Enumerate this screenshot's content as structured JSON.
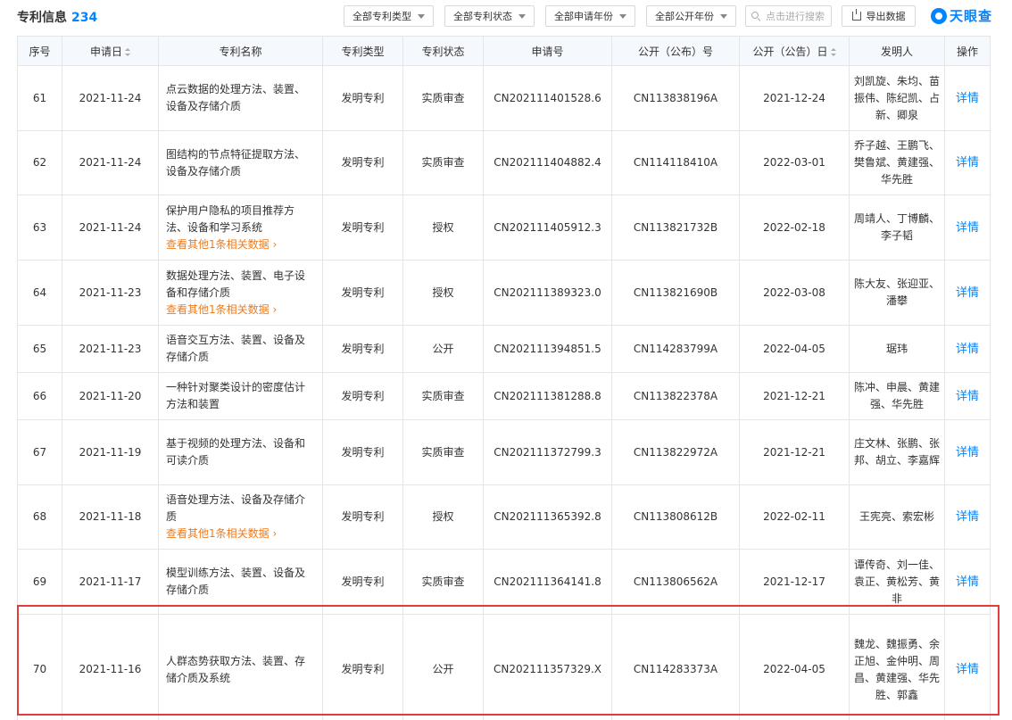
{
  "header": {
    "title": "专利信息",
    "count": "234",
    "filters": [
      "全部专利类型",
      "全部专利状态",
      "全部申请年份",
      "全部公开年份"
    ],
    "search_placeholder": "点击进行搜索",
    "export_label": "导出数据",
    "logo_text": "天眼查"
  },
  "columns": [
    "序号",
    "申请日",
    "专利名称",
    "专利类型",
    "专利状态",
    "申请号",
    "公开（公布）号",
    "公开（公告）日",
    "发明人",
    "操作"
  ],
  "rows": [
    {
      "no": "61",
      "date": "2021-11-24",
      "name": "点云数据的处理方法、装置、设备及存储介质",
      "related": "",
      "type": "发明专利",
      "status": "实质审查",
      "status_kind": "exam",
      "app_no": "CN202111401528.6",
      "pub_no": "CN113838196A",
      "pub_date": "2021-12-24",
      "inventor": "刘凯旋、朱均、苗振伟、陈纪凯、占新、卿泉",
      "action": "详情"
    },
    {
      "no": "62",
      "date": "2021-11-24",
      "name": "图结构的节点特征提取方法、设备及存储介质",
      "related": "",
      "type": "发明专利",
      "status": "实质审查",
      "status_kind": "exam",
      "app_no": "CN202111404882.4",
      "pub_no": "CN114118410A",
      "pub_date": "2022-03-01",
      "inventor": "乔子越、王鹏飞、樊鲁斌、黄建强、华先胜",
      "action": "详情"
    },
    {
      "no": "63",
      "date": "2021-11-24",
      "name": "保护用户隐私的项目推荐方法、设备和学习系统",
      "related": "查看其他1条相关数据",
      "type": "发明专利",
      "status": "授权",
      "status_kind": "grant",
      "app_no": "CN202111405912.3",
      "pub_no": "CN113821732B",
      "pub_date": "2022-02-18",
      "inventor": "周靖人、丁博麟、李子韬",
      "action": "详情"
    },
    {
      "no": "64",
      "date": "2021-11-23",
      "name": "数据处理方法、装置、电子设备和存储介质",
      "related": "查看其他1条相关数据",
      "type": "发明专利",
      "status": "授权",
      "status_kind": "grant",
      "app_no": "CN202111389323.0",
      "pub_no": "CN113821690B",
      "pub_date": "2022-03-08",
      "inventor": "陈大友、张迎亚、潘攀",
      "action": "详情"
    },
    {
      "no": "65",
      "date": "2021-11-23",
      "name": "语音交互方法、装置、设备及存储介质",
      "related": "",
      "type": "发明专利",
      "status": "公开",
      "status_kind": "pub",
      "app_no": "CN202111394851.5",
      "pub_no": "CN114283799A",
      "pub_date": "2022-04-05",
      "inventor": "琚玮",
      "action": "详情"
    },
    {
      "no": "66",
      "date": "2021-11-20",
      "name": "一种针对聚类设计的密度估计方法和装置",
      "related": "",
      "type": "发明专利",
      "status": "实质审查",
      "status_kind": "exam",
      "app_no": "CN202111381288.8",
      "pub_no": "CN113822378A",
      "pub_date": "2021-12-21",
      "inventor": "陈冲、申晨、黄建强、华先胜",
      "action": "详情"
    },
    {
      "no": "67",
      "date": "2021-11-19",
      "name": "基于视频的处理方法、设备和可读介质",
      "related": "",
      "type": "发明专利",
      "status": "实质审查",
      "status_kind": "exam",
      "app_no": "CN202111372799.3",
      "pub_no": "CN113822972A",
      "pub_date": "2021-12-21",
      "inventor": "庄文林、张鹏、张邦、胡立、李嘉辉",
      "action": "详情"
    },
    {
      "no": "68",
      "date": "2021-11-18",
      "name": "语音处理方法、设备及存储介质",
      "related": "查看其他1条相关数据",
      "type": "发明专利",
      "status": "授权",
      "status_kind": "grant",
      "app_no": "CN202111365392.8",
      "pub_no": "CN113808612B",
      "pub_date": "2022-02-11",
      "inventor": "王宪亮、索宏彬",
      "action": "详情"
    },
    {
      "no": "69",
      "date": "2021-11-17",
      "name": "模型训练方法、装置、设备及存储介质",
      "related": "",
      "type": "发明专利",
      "status": "实质审查",
      "status_kind": "exam",
      "app_no": "CN202111364141.8",
      "pub_no": "CN113806562A",
      "pub_date": "2021-12-17",
      "inventor": "谭传奇、刘一佳、袁正、黄松芳、黄非",
      "action": "详情"
    },
    {
      "no": "70",
      "date": "2021-11-16",
      "name": "人群态势获取方法、装置、存储介质及系统",
      "related": "",
      "type": "发明专利",
      "status": "公开",
      "status_kind": "pub",
      "app_no": "CN202111357329.X",
      "pub_no": "CN114283373A",
      "pub_date": "2022-04-05",
      "inventor": "魏龙、魏振勇、余正旭、金仲明、周昌、黄建强、华先胜、郭鑫",
      "action": "详情"
    }
  ]
}
